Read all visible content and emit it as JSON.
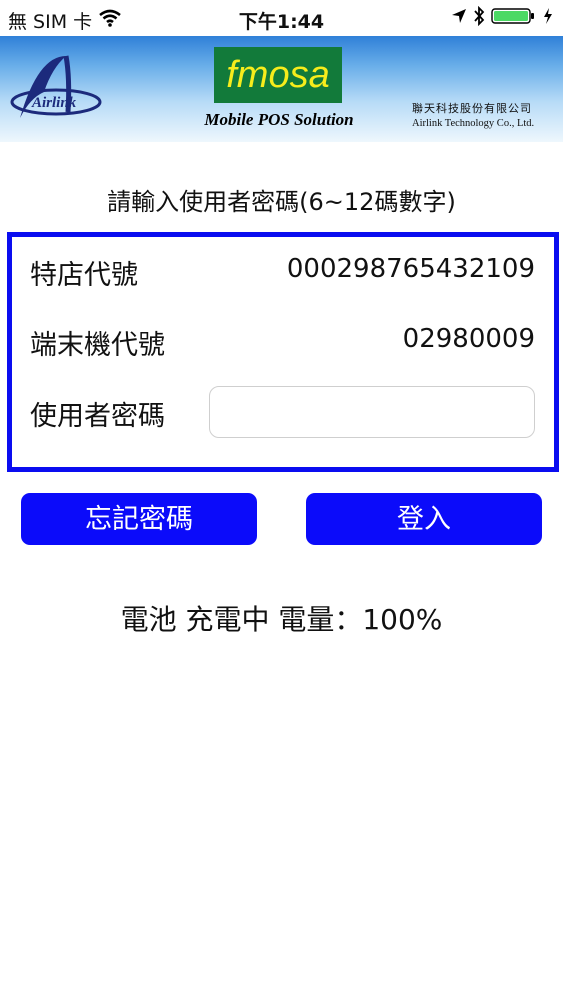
{
  "status_bar": {
    "carrier": "無 SIM 卡",
    "time": "下午1:44"
  },
  "header": {
    "left_logo_text": "Airlink",
    "app_name": "fmosa",
    "tagline": "Mobile POS Solution",
    "company_name_zh": "聯天科技股份有限公司",
    "company_name_en": "Airlink Technology Co., Ltd."
  },
  "form": {
    "prompt": "請輸入使用者密碼(6~12碼數字)",
    "merchant_label": "特店代號",
    "merchant_value": "000298765432109",
    "terminal_label": "端末機代號",
    "terminal_value": "02980009",
    "password_label": "使用者密碼",
    "password_value": ""
  },
  "buttons": {
    "forgot_password": "忘記密碼",
    "login": "登入"
  },
  "battery_status": "電池 充電中 電量：100%",
  "colors": {
    "primary_blue": "#0b0bfa",
    "panel_border": "#0a0df0",
    "fmosa_green": "#127a3a",
    "fmosa_yellow": "#f6ec1c",
    "battery_green": "#4cd964"
  }
}
